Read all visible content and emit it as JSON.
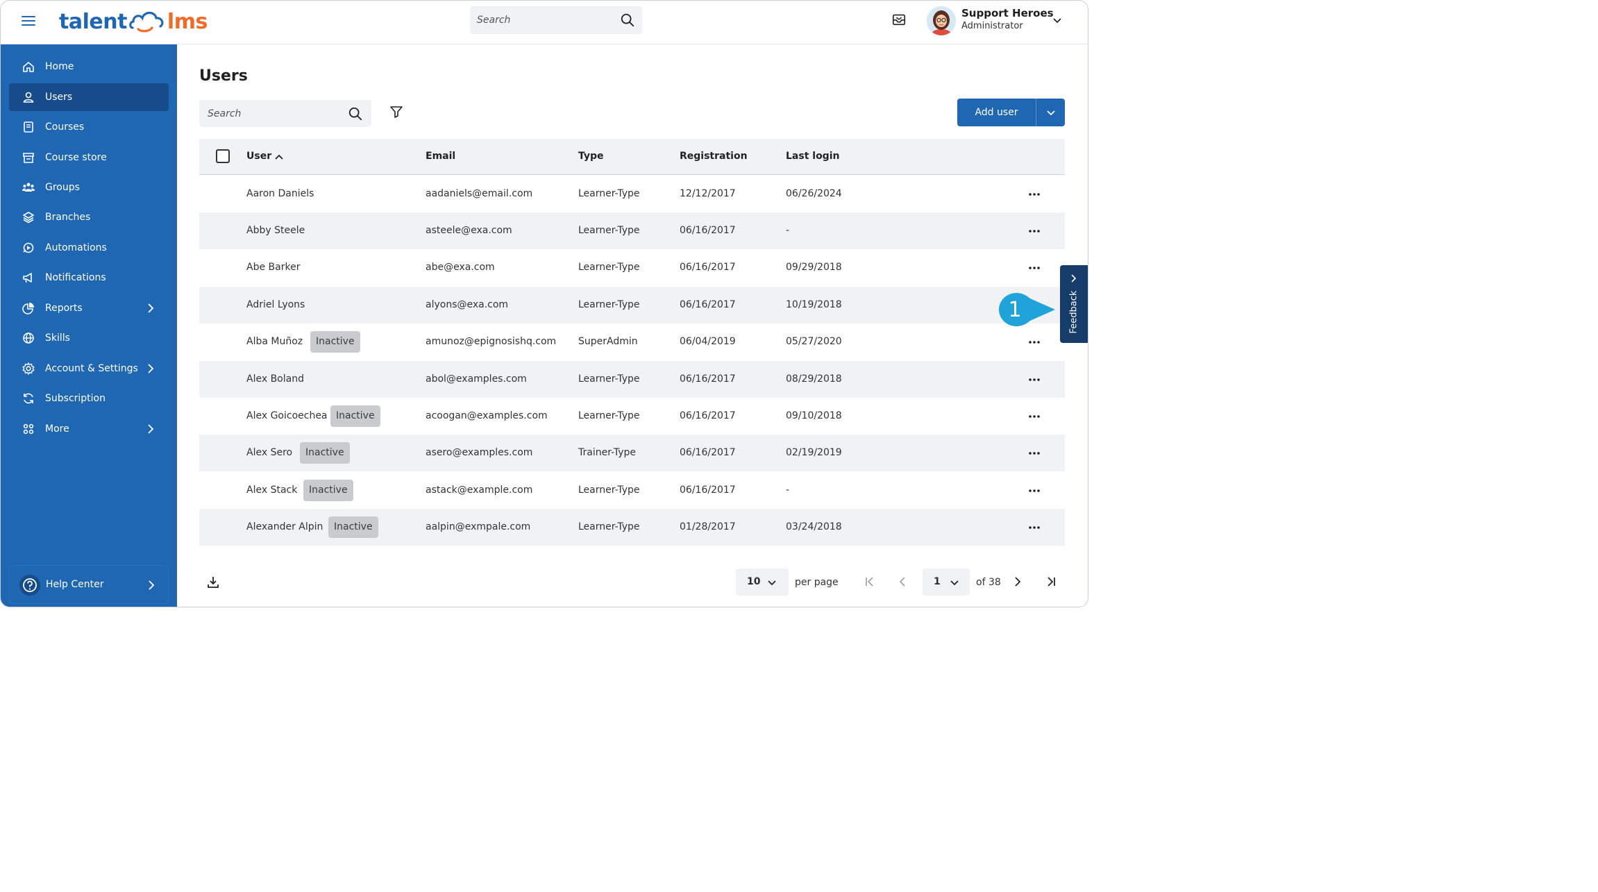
{
  "brand": {
    "text_left": "talent",
    "text_right": "lms",
    "primary_color": "#1f66b3",
    "accent_color": "#f06a28"
  },
  "header": {
    "search_placeholder": "Search",
    "user_name": "Support Heroes",
    "user_role": "Administrator"
  },
  "sidebar": {
    "items": [
      {
        "label": "Home",
        "icon": "home-icon",
        "active": false,
        "has_submenu": false
      },
      {
        "label": "Users",
        "icon": "user-icon",
        "active": true,
        "has_submenu": false
      },
      {
        "label": "Courses",
        "icon": "book-icon",
        "active": false,
        "has_submenu": false
      },
      {
        "label": "Course store",
        "icon": "store-icon",
        "active": false,
        "has_submenu": false
      },
      {
        "label": "Groups",
        "icon": "group-icon",
        "active": false,
        "has_submenu": false
      },
      {
        "label": "Branches",
        "icon": "layers-icon",
        "active": false,
        "has_submenu": false
      },
      {
        "label": "Automations",
        "icon": "automation-icon",
        "active": false,
        "has_submenu": false
      },
      {
        "label": "Notifications",
        "icon": "megaphone-icon",
        "active": false,
        "has_submenu": false
      },
      {
        "label": "Reports",
        "icon": "pie-chart-icon",
        "active": false,
        "has_submenu": true
      },
      {
        "label": "Skills",
        "icon": "globe-icon",
        "active": false,
        "has_submenu": false
      },
      {
        "label": "Account & Settings",
        "icon": "gear-icon",
        "active": false,
        "has_submenu": true
      },
      {
        "label": "Subscription",
        "icon": "refresh-icon",
        "active": false,
        "has_submenu": false
      },
      {
        "label": "More",
        "icon": "grid-icon",
        "active": false,
        "has_submenu": true
      }
    ],
    "help_label": "Help Center"
  },
  "page": {
    "title": "Users",
    "search_placeholder": "Search",
    "add_user_label": "Add user"
  },
  "table": {
    "columns": [
      "User",
      "Email",
      "Type",
      "Registration",
      "Last login"
    ],
    "inactive_label": "Inactive",
    "rows": [
      {
        "name": "Aaron Daniels",
        "inactive": false,
        "email": "aadaniels@email.com",
        "type": "Learner-Type",
        "registration": "12/12/2017",
        "last_login": "06/26/2024"
      },
      {
        "name": "Abby Steele",
        "inactive": false,
        "email": "asteele@exa.com",
        "type": "Learner-Type",
        "registration": "06/16/2017",
        "last_login": "-"
      },
      {
        "name": "Abe Barker",
        "inactive": false,
        "email": "abe@exa.com",
        "type": "Learner-Type",
        "registration": "06/16/2017",
        "last_login": "09/29/2018"
      },
      {
        "name": "Adriel Lyons",
        "inactive": false,
        "email": "alyons@exa.com",
        "type": "Learner-Type",
        "registration": "06/16/2017",
        "last_login": "10/19/2018"
      },
      {
        "name": "Alba Muñoz",
        "inactive": true,
        "email": "amunoz@epignosishq.com",
        "type": "SuperAdmin",
        "registration": "06/04/2019",
        "last_login": "05/27/2020"
      },
      {
        "name": "Alex Boland",
        "inactive": false,
        "email": "abol@examples.com",
        "type": "Learner-Type",
        "registration": "06/16/2017",
        "last_login": "08/29/2018"
      },
      {
        "name": "Alex Goicoechea",
        "inactive": true,
        "email": "acoogan@examples.com",
        "type": "Learner-Type",
        "registration": "06/16/2017",
        "last_login": "09/10/2018"
      },
      {
        "name": "Alex Sero",
        "inactive": true,
        "email": "asero@examples.com",
        "type": "Trainer-Type",
        "registration": "06/16/2017",
        "last_login": "02/19/2019"
      },
      {
        "name": "Alex Stack",
        "inactive": true,
        "email": "astack@example.com",
        "type": "Learner-Type",
        "registration": "06/16/2017",
        "last_login": "-"
      },
      {
        "name": "Alexander Alpin",
        "inactive": true,
        "email": "aalpin@exmpale.com",
        "type": "Learner-Type",
        "registration": "01/28/2017",
        "last_login": "03/24/2018"
      }
    ]
  },
  "pagination": {
    "per_page_value": "10",
    "per_page_label": "per page",
    "current_page": "1",
    "of_label": "of 38"
  },
  "feedback": {
    "label": "Feedback"
  },
  "callout": {
    "number": "1",
    "color": "#1fa3d8"
  }
}
